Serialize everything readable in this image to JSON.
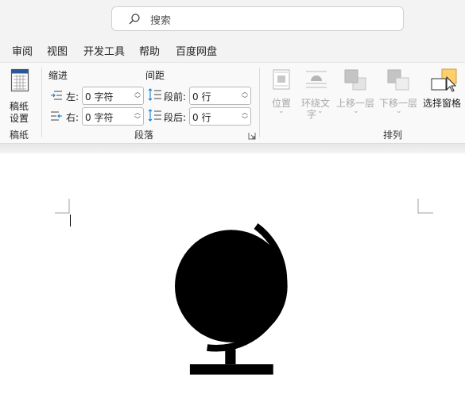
{
  "search": {
    "placeholder": "搜索"
  },
  "menu": {
    "items": [
      {
        "label": "审阅"
      },
      {
        "label": "视图"
      },
      {
        "label": "开发工具"
      },
      {
        "label": "帮助"
      },
      {
        "label": "百度网盘"
      }
    ]
  },
  "ribbon": {
    "paper": {
      "button_line1": "稿纸",
      "button_line2": "设置",
      "group_label": "稿纸"
    },
    "paragraph": {
      "indent_header": "缩进",
      "spacing_header": "间距",
      "left_label": "左:",
      "left_value": "0 字符",
      "right_label": "右:",
      "right_value": "0 字符",
      "before_label": "段前:",
      "before_value": "0 行",
      "after_label": "段后:",
      "after_value": "0 行",
      "group_label": "段落"
    },
    "arrange": {
      "position_label": "位置",
      "wrap_line1": "环绕文",
      "wrap_line2": "字",
      "bring_forward": "上移一层",
      "send_backward": "下移一层",
      "selection_pane": "选择窗格",
      "group_label": "排列"
    }
  },
  "colors": {
    "accent": "#2b579a",
    "spacing_icon": "#0078d4",
    "disabled": "#a8a8a8",
    "selection_pane_yellow": "#ffcf6b"
  }
}
